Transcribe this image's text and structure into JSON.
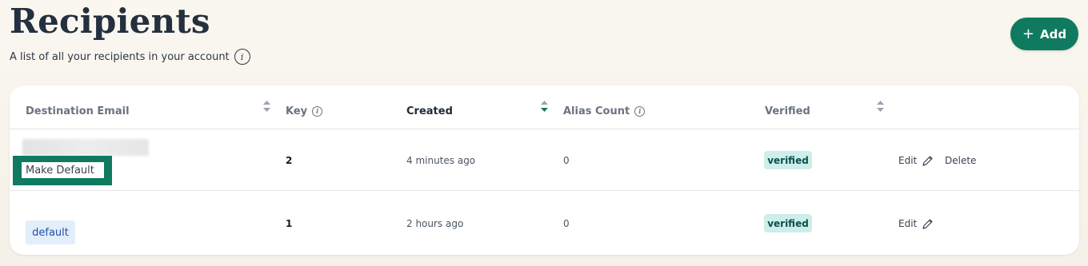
{
  "header": {
    "title": "Recipients",
    "subtitle": "A list of all your recipients in your account",
    "info_icon_glyph": "i",
    "add_button_label": "Add",
    "add_button_icon": "+"
  },
  "table": {
    "columns": [
      {
        "label": "Destination Email",
        "sortable": true
      },
      {
        "label": "Key",
        "info": true
      },
      {
        "label": "Created",
        "sortable": true,
        "active_sort": true
      },
      {
        "label": "Alias Count",
        "info": true
      },
      {
        "label": "Verified",
        "sortable": true
      }
    ],
    "rows": [
      {
        "email_hidden": true,
        "email_action": "Make Default",
        "key": "2",
        "created": "4 minutes ago",
        "alias_count": "0",
        "verified": "verified",
        "actions": {
          "edit": "Edit",
          "delete": "Delete"
        }
      },
      {
        "email_badge": "default",
        "key": "1",
        "created": "2 hours ago",
        "alias_count": "0",
        "verified": "verified",
        "actions": {
          "edit": "Edit"
        }
      }
    ]
  },
  "colors": {
    "accent": "#0f7a5f",
    "verified_bg": "#cdeeea",
    "default_badge_bg": "#e3eefb",
    "sort_active": "#0f7a5f",
    "sort_inactive": "#9ca3af"
  },
  "icons": {
    "sort": "sort-icon",
    "info": "info-icon",
    "edit": "pencil-icon",
    "add": "plus-icon"
  }
}
